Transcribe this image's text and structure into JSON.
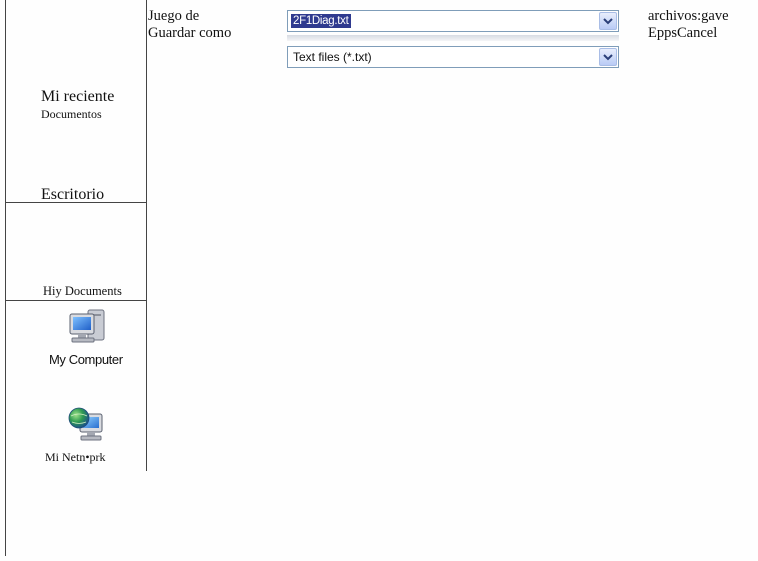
{
  "dialog": {
    "save_in_label_line1": "Juego de",
    "save_in_label_line2": "Guardar como",
    "filename_value": "2F1Diag.txt",
    "filetype_value": "Text files (*.txt)",
    "right_label_line1": "archivos:gave",
    "right_label_line2": "EppsCancel"
  },
  "places": {
    "recent_line1": "Mi reciente",
    "recent_line2": "Documentos",
    "desktop": "Escritorio",
    "my_documents": "Hiy Documents",
    "my_computer": "My Computer",
    "my_network": "Mi Netn•prk"
  },
  "colors": {
    "selection": "#2f3a8f",
    "combo_border": "#7f9db9",
    "dropdown_button": "#b9cbf5"
  },
  "icons": {
    "dropdown": "chevron-down-icon",
    "computer": "computer-icon",
    "network": "network-globe-icon"
  }
}
